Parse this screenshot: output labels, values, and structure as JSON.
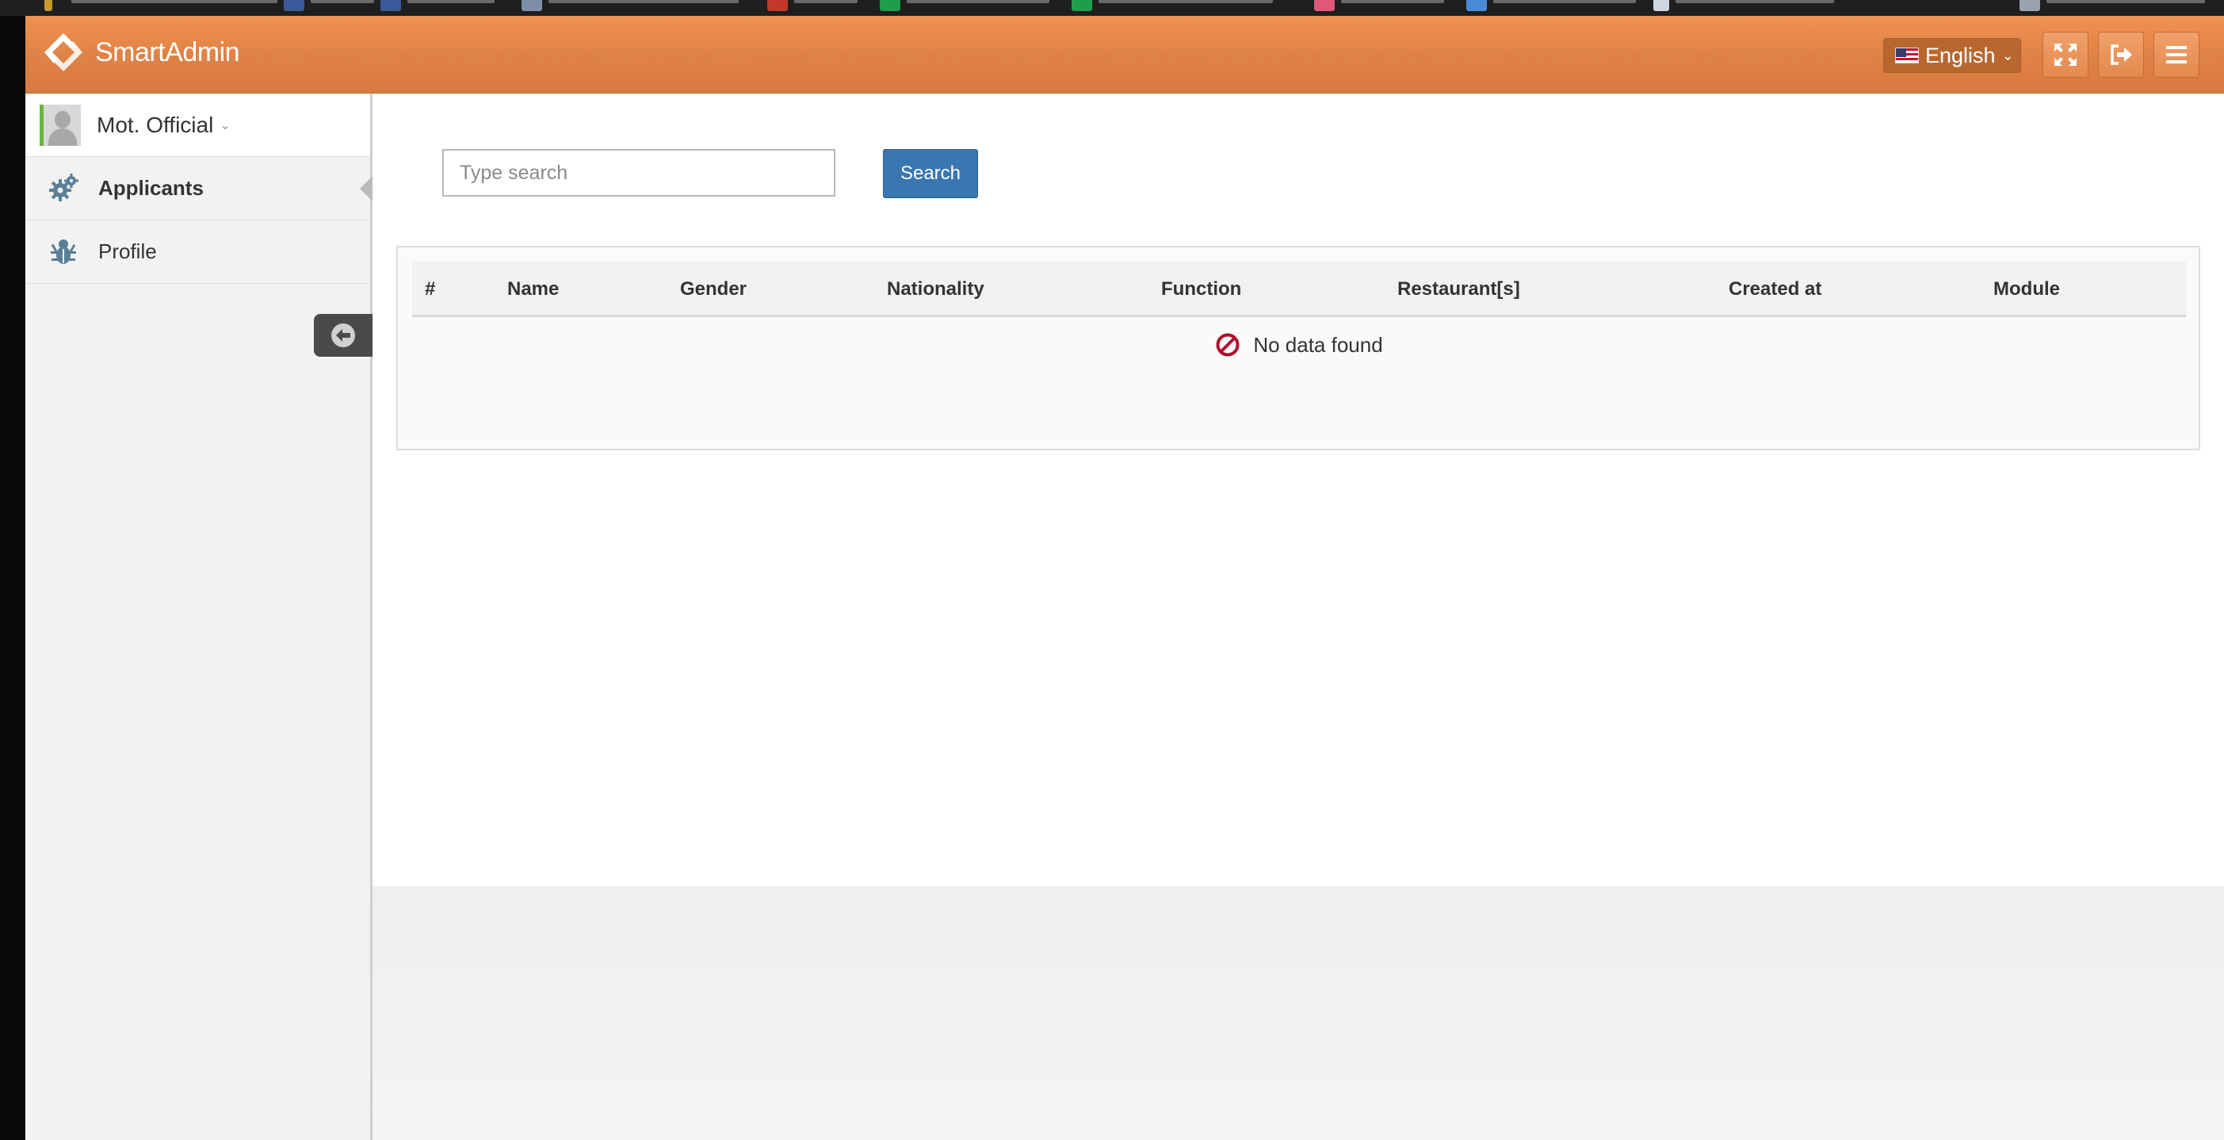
{
  "header": {
    "app_name": "SmartAdmin",
    "language": "English",
    "buttons": {
      "fullscreen_icon": "expand-icon",
      "logout_icon": "sign-out-icon",
      "menu_icon": "hamburger-icon"
    },
    "colors": {
      "bar": "#e08346",
      "language_button": "#b8682f"
    }
  },
  "sidebar": {
    "user": {
      "name": "Mot. Official"
    },
    "items": [
      {
        "label": "Applicants",
        "icon": "gears-icon",
        "active": true
      },
      {
        "label": "Profile",
        "icon": "bug-icon",
        "active": false
      }
    ]
  },
  "main": {
    "search": {
      "placeholder": "Type search",
      "value": "",
      "button_label": "Search"
    },
    "table": {
      "columns": [
        "#",
        "Name",
        "Gender",
        "Nationality",
        "Function",
        "Restaurant[s]",
        "Created at",
        "Module"
      ],
      "rows": [],
      "empty_message": "No data found"
    },
    "colors": {
      "search_button": "#3a76b0",
      "empty_icon": "#b0102a"
    }
  }
}
